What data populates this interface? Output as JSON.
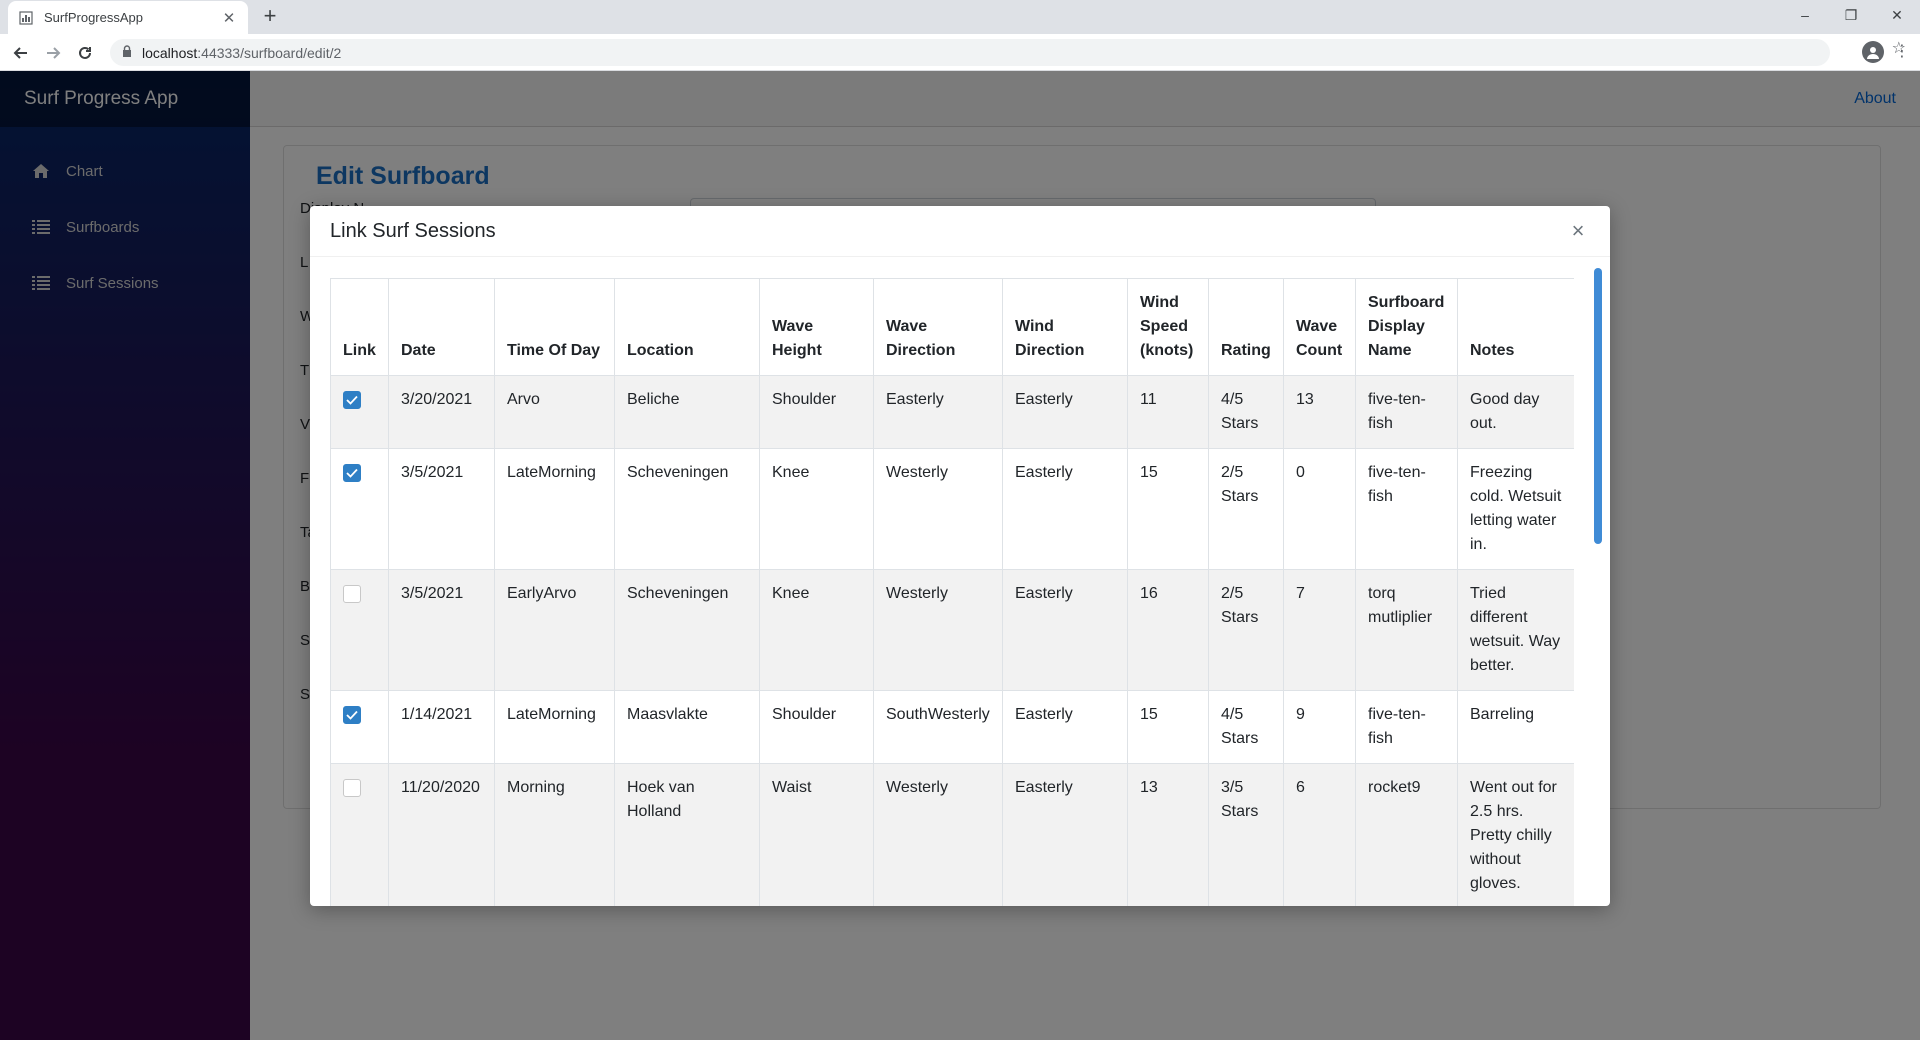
{
  "browser": {
    "tab_title": "SurfProgressApp",
    "url_host": "localhost",
    "url_path": ":44333/surfboard/edit/2"
  },
  "app": {
    "brand": "Surf Progress App",
    "nav": [
      {
        "label": "Chart",
        "icon": "home-icon"
      },
      {
        "label": "Surfboards",
        "icon": "list-icon"
      },
      {
        "label": "Surf Sessions",
        "icon": "list-icon"
      }
    ],
    "about_link": "About",
    "page_title": "Edit Surfboard",
    "form_labels_partial": [
      "Display N",
      "L",
      "W",
      "T",
      "V",
      "F",
      "Ta",
      "B",
      "S",
      "S"
    ]
  },
  "modal": {
    "title": "Link Surf Sessions",
    "close_label": "×",
    "columns": [
      "Link",
      "Date",
      "Time Of Day",
      "Location",
      "Wave Height",
      "Wave Direction",
      "Wind Direction",
      "Wind Speed (knots)",
      "Rating",
      "Wave Count",
      "Surfboard Display Name",
      "Notes"
    ],
    "rows": [
      {
        "linked": true,
        "date": "3/20/2021",
        "time": "Arvo",
        "location": "Beliche",
        "wave_height": "Shoulder",
        "wave_direction": "Easterly",
        "wind_direction": "Easterly",
        "wind_speed": "11",
        "rating": "4/5 Stars",
        "wave_count": "13",
        "surfboard": "five-ten-fish",
        "notes": "Good day out."
      },
      {
        "linked": true,
        "date": "3/5/2021",
        "time": "LateMorning",
        "location": "Scheveningen",
        "wave_height": "Knee",
        "wave_direction": "Westerly",
        "wind_direction": "Easterly",
        "wind_speed": "15",
        "rating": "2/5 Stars",
        "wave_count": "0",
        "surfboard": "five-ten-fish",
        "notes": "Freezing cold. Wetsuit letting water in."
      },
      {
        "linked": false,
        "date": "3/5/2021",
        "time": "EarlyArvo",
        "location": "Scheveningen",
        "wave_height": "Knee",
        "wave_direction": "Westerly",
        "wind_direction": "Easterly",
        "wind_speed": "16",
        "rating": "2/5 Stars",
        "wave_count": "7",
        "surfboard": "torq mutliplier",
        "notes": "Tried different wetsuit. Way better."
      },
      {
        "linked": true,
        "date": "1/14/2021",
        "time": "LateMorning",
        "location": "Maasvlakte",
        "wave_height": "Shoulder",
        "wave_direction": "SouthWesterly",
        "wind_direction": "Easterly",
        "wind_speed": "15",
        "rating": "4/5 Stars",
        "wave_count": "9",
        "surfboard": "five-ten-fish",
        "notes": "Barreling"
      },
      {
        "linked": false,
        "date": "11/20/2020",
        "time": "Morning",
        "location": "Hoek van Holland",
        "wave_height": "Waist",
        "wave_direction": "Westerly",
        "wind_direction": "Easterly",
        "wind_speed": "13",
        "rating": "3/5 Stars",
        "wave_count": "6",
        "surfboard": "rocket9",
        "notes": "Went out for 2.5 hrs. Pretty chilly without gloves."
      }
    ]
  },
  "colors": {
    "accent": "#1b6ec2",
    "checkbox": "#2e7fc5"
  }
}
